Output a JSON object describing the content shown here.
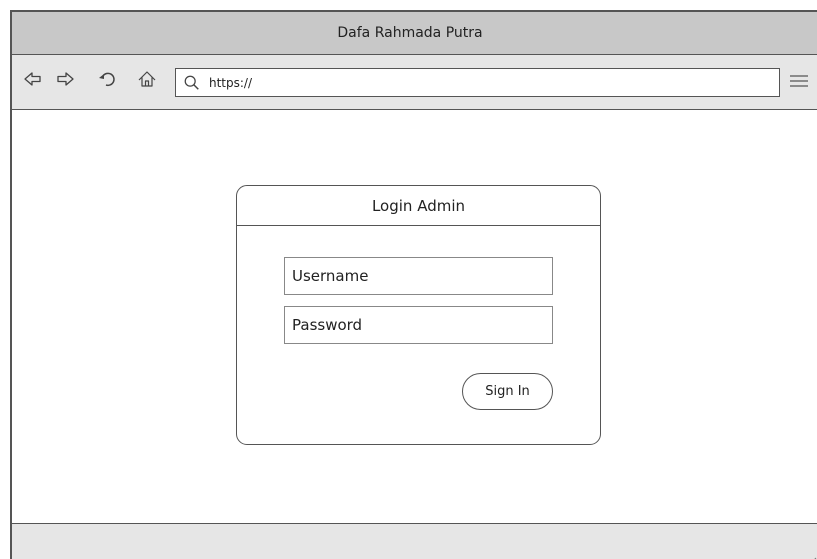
{
  "window": {
    "title": "Dafa Rahmada Putra"
  },
  "toolbar": {
    "address_value": "https://",
    "icons": [
      "back-icon",
      "forward-icon",
      "reload-icon",
      "home-icon",
      "search-icon",
      "menu-icon"
    ]
  },
  "login": {
    "title": "Login Admin",
    "username_placeholder": "Username",
    "password_placeholder": "Password",
    "signin_label": "Sign In"
  },
  "colors": {
    "titlebar": "#c8c8c8",
    "toolbar": "#e6e6e6",
    "border": "#555555"
  }
}
